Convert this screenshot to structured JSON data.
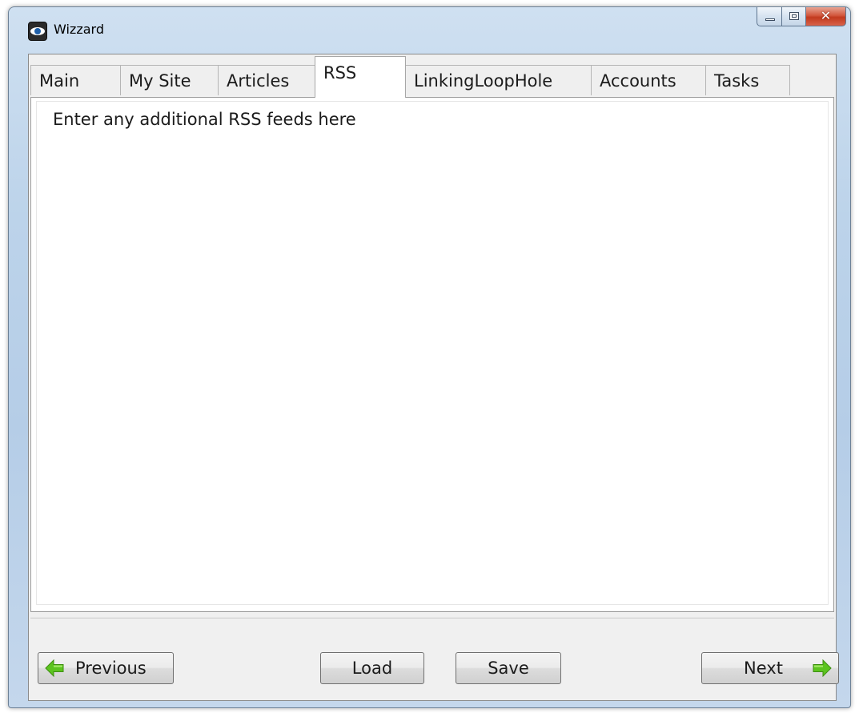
{
  "window": {
    "title": "Wizzard"
  },
  "tabs": [
    {
      "label": "Main",
      "active": false
    },
    {
      "label": "My Site",
      "active": false
    },
    {
      "label": "Articles",
      "active": false
    },
    {
      "label": "RSS",
      "active": true
    },
    {
      "label": "LinkingLoopHole",
      "active": false
    },
    {
      "label": "Accounts",
      "active": false
    },
    {
      "label": "Tasks",
      "active": false
    }
  ],
  "rss_panel": {
    "label": "Enter any additional RSS feeds here"
  },
  "buttons": {
    "previous": "Previous",
    "load": "Load",
    "save": "Save",
    "next": "Next"
  },
  "icons": {
    "app": "eye-icon",
    "previous": "green-arrow-left-icon",
    "next": "green-arrow-right-icon"
  },
  "colors": {
    "arrow_green": "#5cc41f",
    "close_red": "#c23a1e"
  }
}
